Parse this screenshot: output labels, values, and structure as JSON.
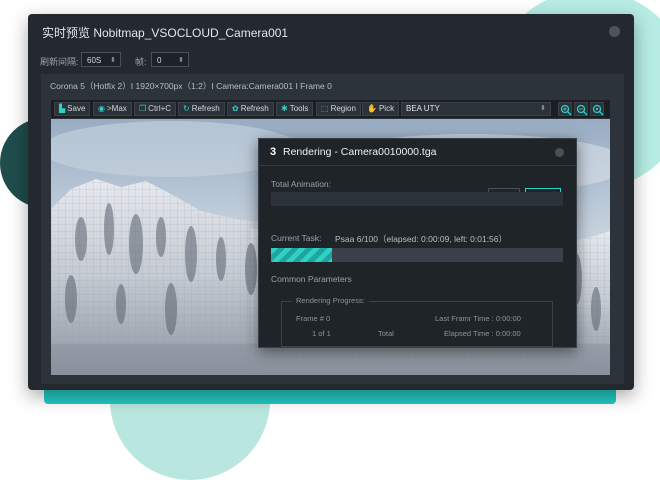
{
  "window": {
    "title": "实时预览   Nobitmap_VSOCLOUD_Camera001"
  },
  "controls": {
    "refresh_label": "刷新间隔:",
    "refresh_value": "60S",
    "frame_label": "帧:",
    "frame_value": "0"
  },
  "info": {
    "text": "Corona 5（Hotfix 2）I 1920×700px（1:2）I Camera:Camera001 I Frame 0"
  },
  "toolbar": {
    "save": "Save",
    "max": ">Max",
    "ctrlc": "Ctrl+C",
    "refresh1": "Refresh",
    "refresh2": "Refresh",
    "tools": "Tools",
    "region": "Region",
    "pick": "Pick",
    "channel": "BEA UTY"
  },
  "dialog": {
    "logo": "3",
    "title": "Rendering - Camera0010000.tga",
    "total_animation_label": "Total Animation:",
    "pause_label": "Pause",
    "cancel_label": "Cannel",
    "current_task_label": "Current Task:",
    "current_task_value": "Psaa 6/100（elapsed: 0:00:09, left: 0:01:56）",
    "progress_fraction": 0.21,
    "common_params_label": "Common Parameters",
    "rendering_progress_label": "Rendering Progress:",
    "frame_label": "Frame # 0",
    "last_frame_label": "Last Framr Time : 0:00:00",
    "one_of_one": "1 of 1",
    "total_label": "Total",
    "elapsed_label": "Elapsed Time : 0:00:00"
  },
  "colors": {
    "accent": "#2fd0c6",
    "window_bg": "#242930",
    "teal_bar": "#23c9c2"
  }
}
